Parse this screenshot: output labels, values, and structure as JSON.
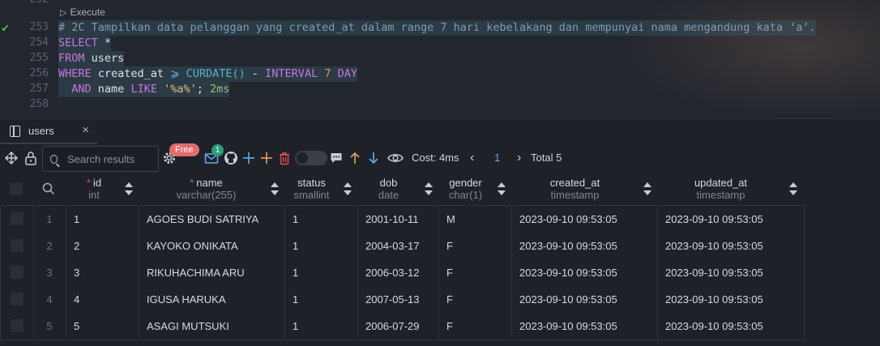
{
  "editor": {
    "execute_label": "Execute",
    "partial_top_number": "252",
    "line_numbers": [
      "253",
      "254",
      "255",
      "256",
      "257",
      "258"
    ],
    "comment": "# 2C Tampilkan data pelanggan yang created_at dalam range 7 hari kebelakang dan mempunyai nama mengandung kata ‘a’.",
    "line2": {
      "kw": "SELECT",
      "rest": " *"
    },
    "line3": {
      "kw": "FROM",
      "rest": " users"
    },
    "line4": {
      "kw": "WHERE",
      "col": " created_at ",
      "op": "⩾",
      "fn": " CURDATE()",
      "minus": " - ",
      "kw2": "INTERVAL",
      "num": " 7 ",
      "kw3": "DAY"
    },
    "line5": {
      "kw": "AND",
      "col": " name ",
      "kw2": "LIKE",
      "str": " '%a%'",
      "semi": ";",
      "timing": " 2ms"
    }
  },
  "tab": {
    "label": "users",
    "close": "×"
  },
  "toolbar": {
    "search_placeholder": "Search results",
    "free_badge": "Free",
    "notify_count": "1",
    "cost_label": "Cost: 4ms",
    "prev": "‹",
    "page": "1",
    "next": "›",
    "total": "Total 5"
  },
  "colors": {
    "accent": "#61afef",
    "required": "#e05252",
    "add": "#e5a05c",
    "free_badge": "#e06c6c",
    "notify_badge": "#2e9c7a"
  },
  "icons": [
    "move-icon",
    "lock-icon",
    "gear-icon",
    "mail-icon",
    "github-icon",
    "add-row-icon",
    "add-column-icon",
    "delete-icon",
    "comment-icon",
    "arrow-up-icon",
    "arrow-down-icon",
    "eye-icon"
  ],
  "table": {
    "columns": [
      {
        "name": "id",
        "type": "int",
        "required": true
      },
      {
        "name": "name",
        "type": "varchar(255)",
        "required": true
      },
      {
        "name": "status",
        "type": "smallint",
        "required": false
      },
      {
        "name": "dob",
        "type": "date",
        "required": false
      },
      {
        "name": "gender",
        "type": "char(1)",
        "required": false
      },
      {
        "name": "created_at",
        "type": "timestamp",
        "required": false
      },
      {
        "name": "updated_at",
        "type": "timestamp",
        "required": false
      }
    ],
    "rows": [
      [
        "1",
        "1",
        "AGOES BUDI SATRIYA",
        "1",
        "2001-10-11",
        "M",
        "2023-09-10 09:53:05",
        "2023-09-10 09:53:05"
      ],
      [
        "2",
        "2",
        "KAYOKO ONIKATA",
        "1",
        "2004-03-17",
        "F",
        "2023-09-10 09:53:05",
        "2023-09-10 09:53:05"
      ],
      [
        "3",
        "3",
        "RIKUHACHIMA ARU",
        "1",
        "2006-03-12",
        "F",
        "2023-09-10 09:53:05",
        "2023-09-10 09:53:05"
      ],
      [
        "4",
        "4",
        "IGUSA HARUKA",
        "1",
        "2007-05-13",
        "F",
        "2023-09-10 09:53:05",
        "2023-09-10 09:53:05"
      ],
      [
        "5",
        "5",
        "ASAGI MUTSUKI",
        "1",
        "2006-07-29",
        "F",
        "2023-09-10 09:53:05",
        "2023-09-10 09:53:05"
      ]
    ]
  }
}
